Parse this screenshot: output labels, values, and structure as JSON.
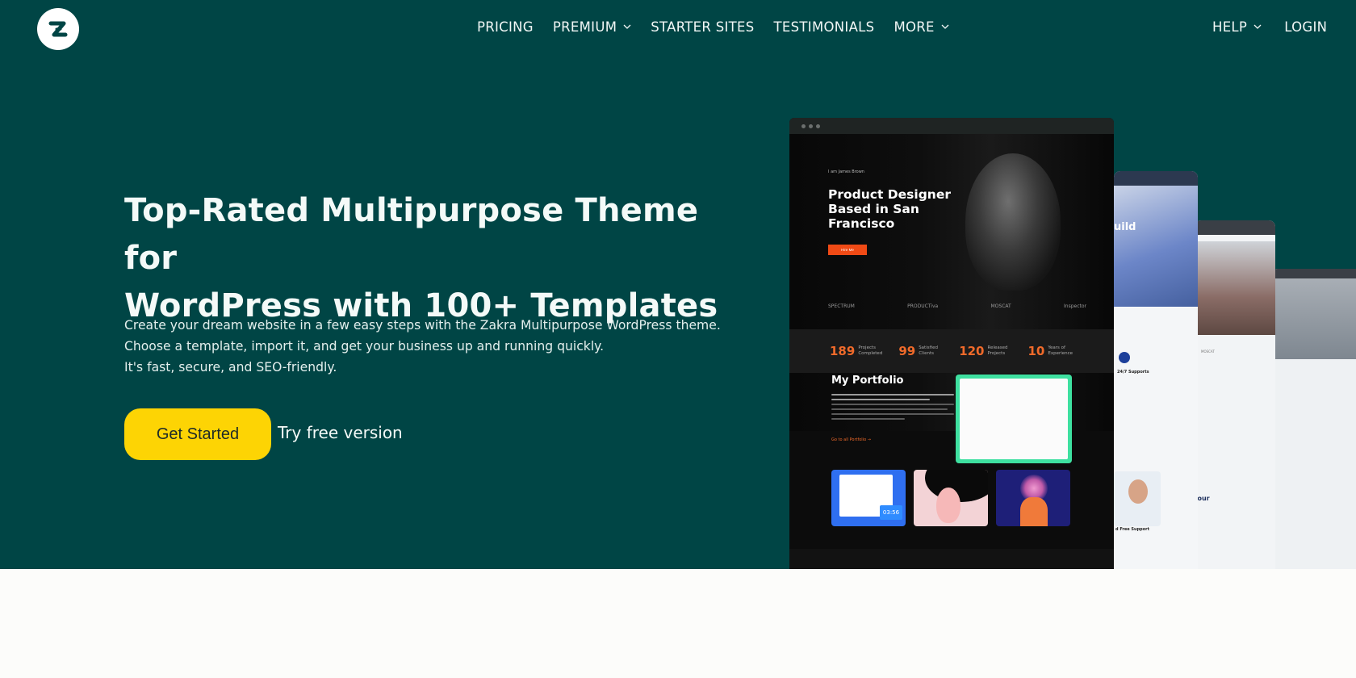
{
  "header": {
    "logo_icon": "zakra-logo-icon",
    "nav_left": [
      {
        "label": "PRICING",
        "dropdown": false
      },
      {
        "label": "PREMIUM",
        "dropdown": true
      },
      {
        "label": "STARTER SITES",
        "dropdown": false
      },
      {
        "label": "TESTIMONIALS",
        "dropdown": false
      },
      {
        "label": "MORE",
        "dropdown": true
      }
    ],
    "nav_right": [
      {
        "label": "HELP",
        "dropdown": true
      },
      {
        "label": "LOGIN",
        "dropdown": false
      }
    ]
  },
  "hero": {
    "headline_line1": "Top-Rated Multipurpose Theme for",
    "headline_line2": "WordPress with 100+ Templates",
    "description": [
      "Create your dream website in a few easy steps with the Zakra Multipurpose WordPress theme.",
      "Choose a template, import it, and get your business up and running quickly.",
      "It's fast, secure, and SEO-friendly."
    ],
    "primary_button": "Get Started",
    "secondary_link": "Try free version"
  },
  "showcase": {
    "main": {
      "small_intro": "I am James Brown",
      "title": "Product Designer Based in San Francisco",
      "cta": "Hire Me",
      "logos": [
        "SPECTRUM",
        "PRODUCTiva",
        "MOSCAT",
        "Inspector"
      ],
      "stats": [
        {
          "num": "189",
          "label": "Projects Completed"
        },
        {
          "num": "99",
          "label": "Satisfied Clients"
        },
        {
          "num": "120",
          "label": "Released Projects"
        },
        {
          "num": "10",
          "label": "Years of Experience"
        }
      ],
      "portfolio_title": "My Portfolio",
      "portfolio_link": "Go to all Portfolio →",
      "time_badge": "03:56"
    },
    "second": {
      "headline_fragment": "uild",
      "support_label": "24/7 Supports",
      "free_label": "d Free Support"
    },
    "third": {
      "fragment": "four",
      "brand": "MOSCAT"
    }
  },
  "colors": {
    "hero_bg": "#004545",
    "accent_yellow": "#fdd404",
    "orange": "#f06a2a",
    "band_bg": "#fcfcfa"
  }
}
